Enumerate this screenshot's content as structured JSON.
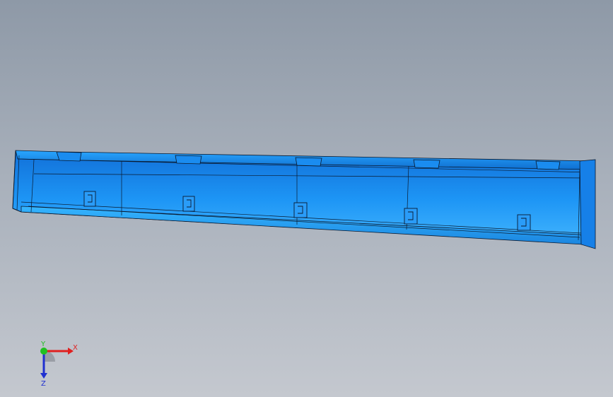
{
  "viewport": {
    "background_top": "#8e99a7",
    "background_bottom": "#c4c8cf"
  },
  "model": {
    "name": "side-sill-trim-part",
    "face_color": "#1a8cf0",
    "highlight_color": "#3fb0ff",
    "edge_color": "#0a1a30",
    "clip_count": 10
  },
  "triad": {
    "x_label": "X",
    "y_label": "Y",
    "z_label": "Z",
    "x_color": "#e02020",
    "y_color": "#20c020",
    "z_color": "#2030d0"
  }
}
